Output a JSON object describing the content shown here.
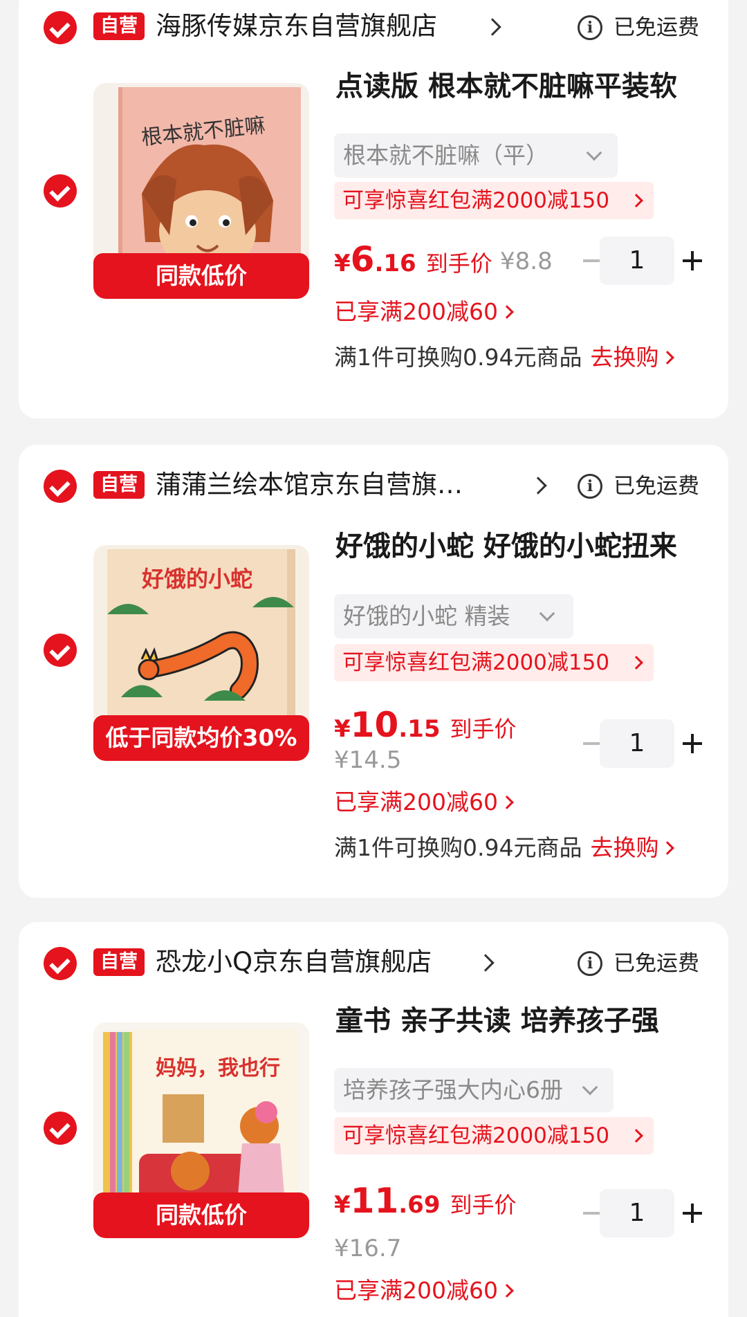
{
  "colors": {
    "accent": "#e4131d",
    "background": "#f3f3f3",
    "card": "#ffffff"
  },
  "shops": [
    {
      "self_badge": "自营",
      "name": "海豚传媒京东自营旗舰店",
      "shipping": "已免运费",
      "item": {
        "title": "点读版 根本就不脏嘛平装软",
        "variant": "根本就不脏嘛（平）",
        "coupon": "可享惊喜红包满2000减150",
        "price_symbol": "¥",
        "price_int": "6",
        "price_dec": ".16",
        "price_label": "到手价",
        "original_price": "¥8.8",
        "quantity": "1",
        "promo": "已享满200减60",
        "swap_text": "满1件可换购0.94元商品",
        "swap_link": "去换购",
        "thumb_tag": "同款低价",
        "cover_title": "根本就不脏嘛"
      }
    },
    {
      "self_badge": "自营",
      "name": "蒲蒲兰绘本馆京东自营旗…",
      "shipping": "已免运费",
      "item": {
        "title": "好饿的小蛇 好饿的小蛇扭来",
        "variant": "好饿的小蛇 精装",
        "coupon": "可享惊喜红包满2000减150",
        "price_symbol": "¥",
        "price_int": "10",
        "price_dec": ".15",
        "price_label": "到手价",
        "original_price": "¥14.5",
        "quantity": "1",
        "promo": "已享满200减60",
        "swap_text": "满1件可换购0.94元商品",
        "swap_link": "去换购",
        "thumb_tag": "低于同款均价30%",
        "cover_title": "好饿的小蛇"
      }
    },
    {
      "self_badge": "自营",
      "name": "恐龙小Q京东自营旗舰店",
      "shipping": "已免运费",
      "item": {
        "title": "童书 亲子共读  培养孩子强",
        "variant": "培养孩子强大内心6册",
        "coupon": "可享惊喜红包满2000减150",
        "price_symbol": "¥",
        "price_int": "11",
        "price_dec": ".69",
        "price_label": "到手价",
        "original_price": "¥16.7",
        "quantity": "1",
        "promo": "已享满200减60",
        "thumb_tag": "同款低价",
        "cover_title": "妈妈，我也行"
      }
    }
  ]
}
